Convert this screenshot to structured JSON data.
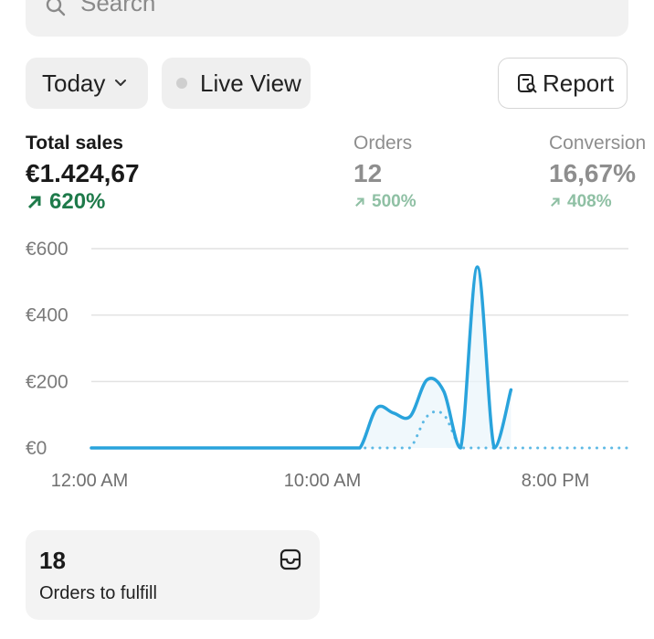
{
  "search": {
    "placeholder": "Search"
  },
  "filters": {
    "date_range": "Today",
    "live_view": "Live View",
    "report": "Report"
  },
  "metrics": [
    {
      "label": "Total sales",
      "value": "€1.424,67",
      "change": "620%"
    },
    {
      "label": "Orders",
      "value": "12",
      "change": "500%"
    },
    {
      "label": "Conversion",
      "value": "16,67%",
      "change": "408%"
    }
  ],
  "colors": {
    "accent": "#29a3dc",
    "positive": "#1e7a4a",
    "muted_positive": "#8fc0a4"
  },
  "chart_data": {
    "type": "line",
    "y_tick_labels": [
      "€600",
      "€400",
      "€200",
      "€0"
    ],
    "x_tick_labels": [
      "12:00 AM",
      "10:00 AM",
      "8:00 PM"
    ],
    "ylim": [
      0,
      600
    ],
    "grid": true,
    "series": [
      {
        "style": "solid",
        "x": [
          0,
          0.5,
          1,
          1.5,
          2,
          2.5,
          3,
          3.5,
          4,
          4.5,
          5,
          5.5,
          6,
          6.5,
          7,
          7.5,
          8,
          8.5,
          9,
          9.5,
          10,
          10.5,
          11,
          11.5,
          12,
          12.5,
          13,
          13.5,
          14,
          14.5,
          15,
          15.5,
          16
        ],
        "values": [
          0,
          0,
          0,
          0,
          0,
          0,
          0,
          0,
          0,
          0,
          0,
          0,
          0,
          0,
          0,
          0,
          0,
          120,
          105,
          95,
          205,
          170,
          0,
          545,
          0,
          175,
          null,
          null,
          null,
          null,
          null,
          null,
          null
        ]
      },
      {
        "style": "dotted",
        "x": [
          0,
          0.5,
          1,
          1.5,
          2,
          2.5,
          3,
          3.5,
          4,
          4.5,
          5,
          5.5,
          6,
          6.5,
          7,
          7.5,
          8,
          8.5,
          9,
          9.5,
          10,
          10.5,
          11,
          11.5,
          12,
          12.5,
          13,
          13.5,
          14,
          14.5,
          15,
          15.5,
          16
        ],
        "values": [
          0,
          0,
          0,
          0,
          0,
          0,
          0,
          0,
          0,
          0,
          0,
          0,
          0,
          0,
          0,
          0,
          0,
          0,
          0,
          0,
          95,
          100,
          0,
          0,
          0,
          0,
          0,
          0,
          0,
          0,
          0,
          0,
          0
        ]
      }
    ]
  },
  "fulfill": {
    "count": "18",
    "label": "Orders to fulfill"
  }
}
